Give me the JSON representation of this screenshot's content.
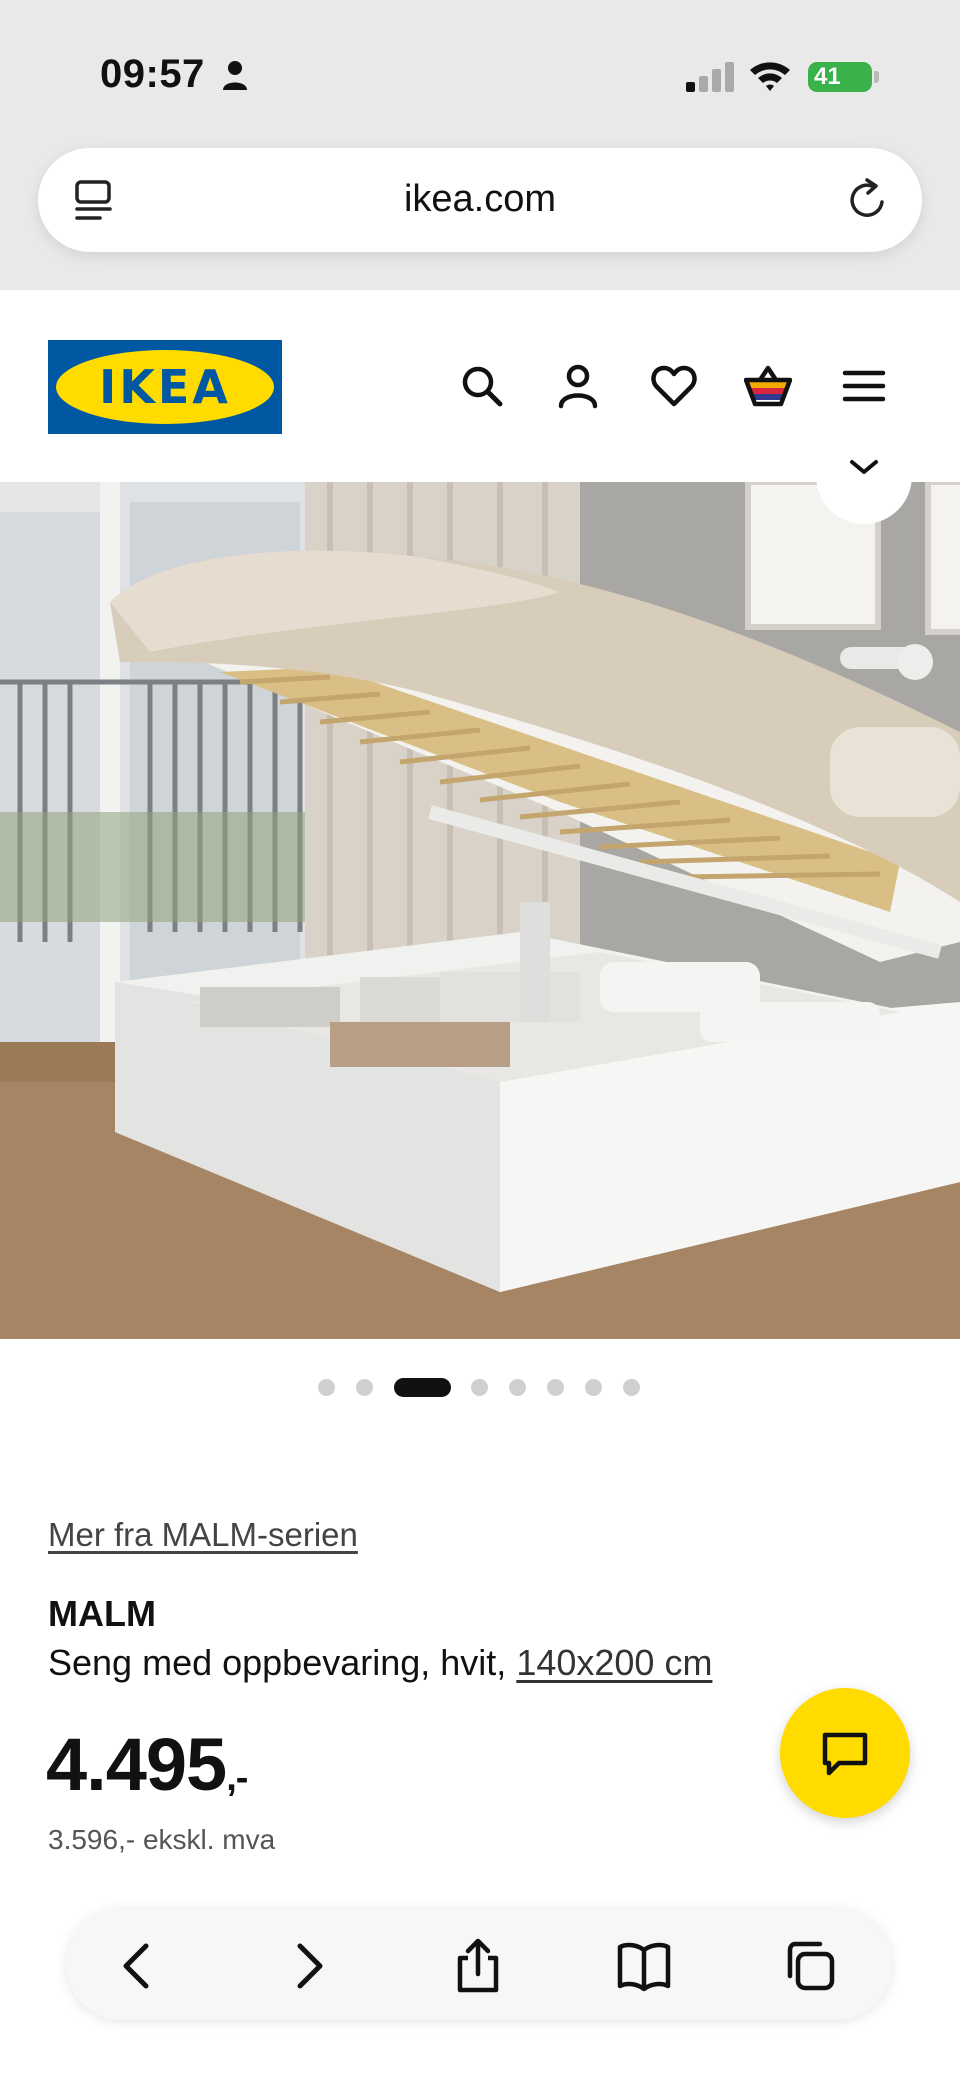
{
  "status_bar": {
    "time": "09:57",
    "battery": "41"
  },
  "browser": {
    "url": "ikea.com"
  },
  "header": {
    "logo_text": "IKEA",
    "icons": [
      "search-icon",
      "account-icon",
      "heart-icon",
      "cart-icon",
      "menu-icon"
    ]
  },
  "gallery": {
    "image_count": 8,
    "active_index": 2
  },
  "product": {
    "series_link": "Mer fra MALM-serien",
    "name": "MALM",
    "description": "Seng med oppbevaring, hvit, ",
    "size_link": "140x200 cm",
    "price": "4.495",
    "price_suffix": ",-",
    "price_ex_vat": "3.596,- ekskl. mva"
  },
  "colors": {
    "ikea_blue": "#0058a3",
    "ikea_yellow": "#ffdb00",
    "battery_green": "#38b249"
  },
  "toolbar": {
    "buttons": [
      "back-icon",
      "forward-icon",
      "share-icon",
      "bookmarks-icon",
      "tabs-icon"
    ]
  }
}
